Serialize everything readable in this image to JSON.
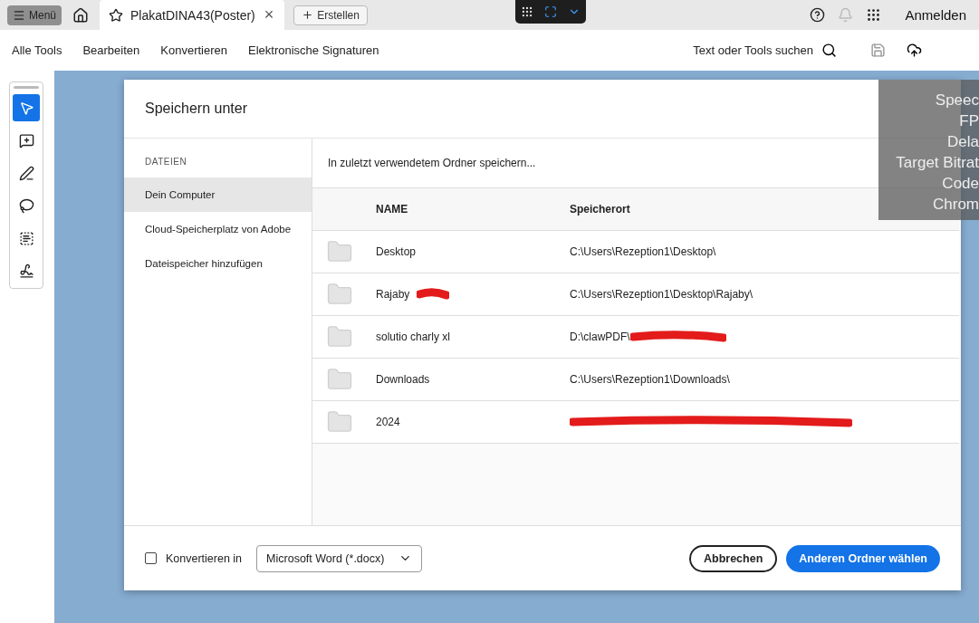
{
  "topbar": {
    "menu": "Menü",
    "tab": {
      "title": "PlakatDINA43(Poster)",
      "close": "×"
    },
    "create": "Erstellen",
    "signin": "Anmelden"
  },
  "toolbar": {
    "items": [
      {
        "label": "Alle Tools"
      },
      {
        "label": "Bearbeiten"
      },
      {
        "label": "Konvertieren"
      },
      {
        "label": "Elektronische Signaturen"
      }
    ],
    "search": "Text oder Tools suchen"
  },
  "tools": [
    {
      "kind": "select",
      "selected": true
    },
    {
      "kind": "comment",
      "selected": false
    },
    {
      "kind": "draw",
      "selected": false
    },
    {
      "kind": "lasso",
      "selected": false
    },
    {
      "kind": "textbox",
      "selected": false
    },
    {
      "kind": "sign",
      "selected": false
    }
  ],
  "stats_overlay": [
    "Speec",
    "FP",
    "Dela",
    "Target Bitrat",
    "Code",
    "Chrom"
  ],
  "dialog": {
    "title": "Speichern unter",
    "sidebar": {
      "heading": "DATEIEN",
      "items": [
        {
          "label": "Dein Computer",
          "selected": true
        },
        {
          "label": "Cloud-Speicherplatz von Adobe",
          "selected": false
        },
        {
          "label": "Dateispeicher hinzufügen",
          "selected": false
        }
      ]
    },
    "subtitle": "In zuletzt verwendetem Ordner speichern...",
    "columns": [
      "NAME",
      "Speicherort"
    ],
    "rows": [
      {
        "name": "Desktop",
        "location": "C:\\Users\\Rezeption1\\Desktop\\",
        "name_redacted": false,
        "location_redacted": false
      },
      {
        "name": "Rajaby",
        "location": "C:\\Users\\Rezeption1\\Desktop\\Rajaby\\",
        "name_redacted": true,
        "location_redacted": false
      },
      {
        "name": "solutio charly xl",
        "location": "D:\\clawPDF\\",
        "name_redacted": false,
        "location_redacted": true
      },
      {
        "name": "Downloads",
        "location": "C:\\Users\\Rezeption1\\Downloads\\",
        "name_redacted": false,
        "location_redacted": false
      },
      {
        "name": "2024",
        "name_redacted": false,
        "location_redacted": true
      }
    ],
    "convert": {
      "label": "Konvertieren in",
      "checked": false,
      "format": "Microsoft Word (*.docx)"
    },
    "cancel": "Abbrechen",
    "confirm": "Anderen Ordner wählen"
  }
}
